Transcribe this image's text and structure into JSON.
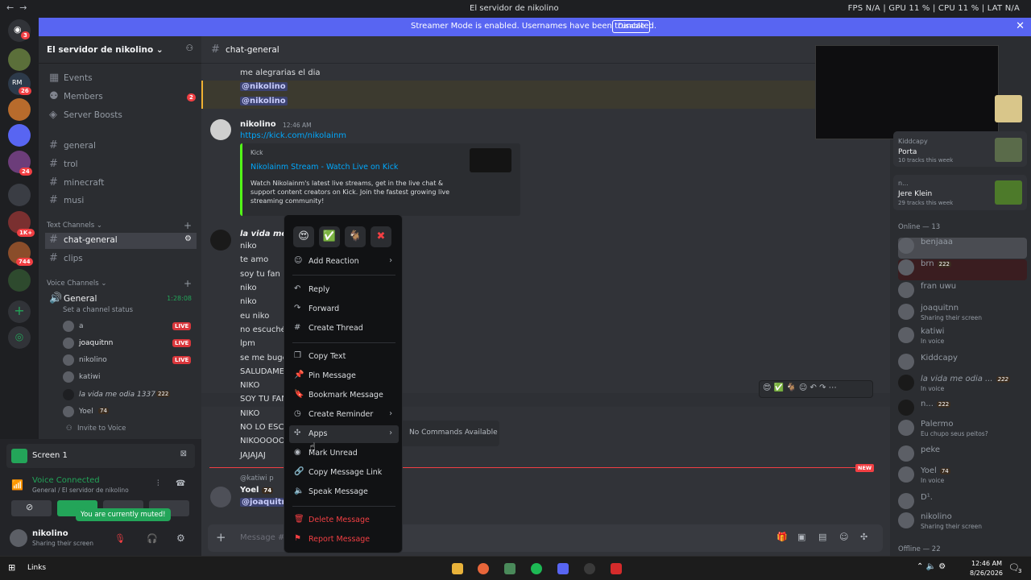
{
  "window": {
    "title": "El servidor de nikolino",
    "stats": "FPS N/A  |  GPU 11 %  |  CPU 11 %  |  LAT N/A"
  },
  "streamer": {
    "text": "Streamer Mode is enabled. Usernames have been truncated.",
    "disable_label": "Disable"
  },
  "rail": {
    "badges": [
      "3",
      "26",
      "24",
      "1K+",
      "744"
    ]
  },
  "server": {
    "name": "El servidor de nikolino",
    "top_items": [
      {
        "label": "Events",
        "icon": "calendar-icon"
      },
      {
        "label": "Members",
        "icon": "members-icon",
        "badge": "2"
      },
      {
        "label": "Server Boosts",
        "icon": "boost-icon"
      }
    ],
    "channels_top": [
      "general",
      "trol",
      "minecraft",
      "musi"
    ],
    "text_category": "Text Channels",
    "text_channels": [
      "chat-general",
      "clips"
    ],
    "voice_category": "Voice Channels",
    "voice_channel": {
      "name": "General",
      "time": "1:28:08",
      "status": "Set a channel status"
    },
    "voice_users": [
      {
        "name": "a",
        "live": "LIVE"
      },
      {
        "name": "joaquitnn",
        "live": "LIVE"
      },
      {
        "name": "nikolino",
        "live": "LIVE"
      },
      {
        "name": "katiwi"
      },
      {
        "name": "la vida me odia 1337",
        "tag": "222"
      },
      {
        "name": "Yoel",
        "tag": "74"
      }
    ],
    "invite": "Invite to Voice"
  },
  "bottom": {
    "screen": "Screen 1",
    "voice_connected": "Voice Connected",
    "voice_sub": "General / El servidor de nikolino",
    "muted_tooltip": "You are currently muted!",
    "user_name": "nikolino",
    "user_status": "Sharing their screen"
  },
  "chat": {
    "channel": "chat-general",
    "lines_top": [
      "me alegrarias el dia"
    ],
    "mentions": [
      "@nikolino",
      "@nikolino"
    ],
    "msg1": {
      "author": "nikolino",
      "time": "12:46 AM",
      "link": "https://kick.com/nikolainm",
      "embed_provider": "Kick",
      "embed_title": "Nikolainm Stream - Watch Live on Kick",
      "embed_desc": "Watch Nikolainm's latest live streams, get in the live chat & support content creators on Kick. Join the fastest growing live streaming community!"
    },
    "msg2": {
      "author": "la vida me o",
      "lines": [
        "niko",
        "te amo",
        "soy tu fan",
        "niko",
        "niko",
        "eu niko",
        "no escuché",
        "lpm",
        "se me bugeo",
        "SALUDAME",
        "NIKO",
        "SOY TU FAN",
        "NIKO",
        "NO LO ESCU",
        "NIKOOOOO",
        "JAJAJAJ"
      ]
    },
    "new_label": "NEW",
    "reply_ref": "@katiwi p",
    "msg3": {
      "author": "Yoel",
      "tag": "74",
      "mention": "@joaquitnn"
    },
    "placeholder": "Message #c"
  },
  "apps_submenu": "No Commands Available",
  "menu": {
    "reactions": [
      "😍",
      "✅",
      "🐐",
      "✖"
    ],
    "items": [
      {
        "label": "Add Reaction",
        "icon": "emoji-icon",
        "arrow": true
      },
      {
        "label": "Reply",
        "icon": "reply-icon"
      },
      {
        "label": "Forward",
        "icon": "forward-icon"
      },
      {
        "label": "Create Thread",
        "icon": "thread-icon"
      },
      {
        "label": "Copy Text",
        "icon": "copy-icon"
      },
      {
        "label": "Pin Message",
        "icon": "pin-icon"
      },
      {
        "label": "Bookmark Message",
        "icon": "bookmark-icon"
      },
      {
        "label": "Create Reminder",
        "icon": "clock-icon",
        "arrow": true
      },
      {
        "label": "Apps",
        "icon": "apps-icon",
        "arrow": true
      },
      {
        "label": "Mark Unread",
        "icon": "unread-icon"
      },
      {
        "label": "Copy Message Link",
        "icon": "link-icon"
      },
      {
        "label": "Speak Message",
        "icon": "speaker-icon"
      },
      {
        "label": "Delete Message",
        "icon": "trash-icon"
      },
      {
        "label": "Report Message",
        "icon": "flag-icon"
      }
    ]
  },
  "right": {
    "activity": [
      {
        "top": "Kiddcapy",
        "name": "Porta",
        "sub": "10 tracks this week"
      },
      {
        "top": "n...",
        "name": "Jere Klein",
        "sub": "29 tracks this week"
      }
    ],
    "online_header": "Online — 13",
    "members": [
      {
        "name": "benjaaa"
      },
      {
        "name": "brn",
        "tag": "222"
      },
      {
        "name": "fran uwu"
      },
      {
        "name": "joaquitnn",
        "status": "Sharing their screen"
      },
      {
        "name": "katiwi",
        "status": "In voice"
      },
      {
        "name": "Kiddcapy"
      },
      {
        "name": "la vida me odia ...",
        "tag": "222",
        "status": "In voice"
      },
      {
        "name": "n...",
        "tag": "222"
      },
      {
        "name": "Palermo",
        "status": "Eu chupo seus peitos?"
      },
      {
        "name": "peke"
      },
      {
        "name": "Yoel",
        "tag": "74",
        "status": "In voice"
      },
      {
        "name": "D¹."
      },
      {
        "name": "nikolino",
        "status": "Sharing their screen"
      }
    ],
    "offline_header": "Offline — 22"
  },
  "taskbar": {
    "links": "Links",
    "time": "12:46 AM",
    "date": "8/26/2026",
    "notif": "3"
  }
}
